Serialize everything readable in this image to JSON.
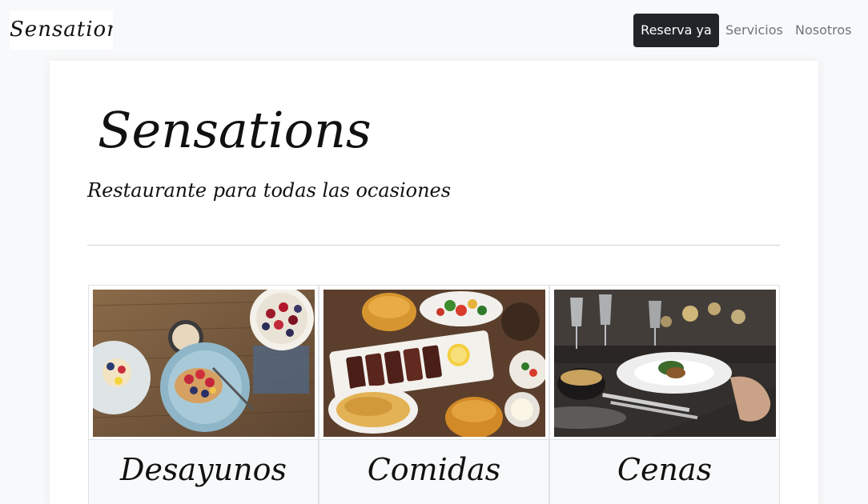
{
  "brand": {
    "logo_text": "Sensation"
  },
  "nav": {
    "cta_label": "Reserva ya",
    "links": [
      "Servicios",
      "Nosotros"
    ]
  },
  "hero": {
    "title": "Sensations",
    "subtitle": "Restaurante para todas las ocasiones"
  },
  "services": [
    {
      "label": "Desayunos",
      "image_icon": "breakfast-photo"
    },
    {
      "label": "Comidas",
      "image_icon": "lunch-photo"
    },
    {
      "label": "Cenas",
      "image_icon": "dinner-photo"
    }
  ]
}
